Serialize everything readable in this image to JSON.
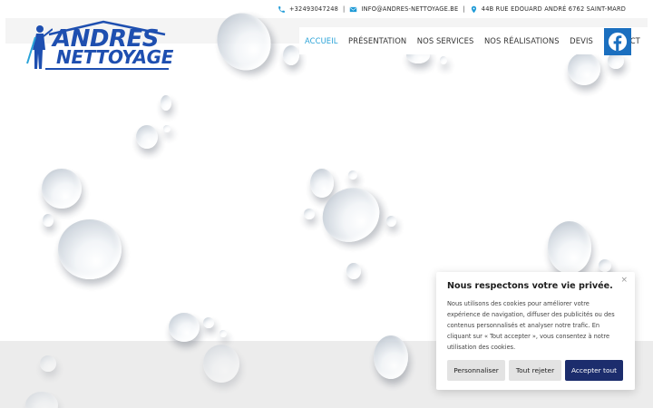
{
  "topbar": {
    "phone": "+32493047248",
    "email": "INFO@ANDRES-NETTOYAGE.BE",
    "address": "44B RUE EDOUARD ANDRÉ 6762 SAINT-MARD",
    "separator": "|"
  },
  "logo": {
    "line1": "ANDRES",
    "line2": "NETTOYAGE"
  },
  "nav": {
    "items": [
      {
        "label": "ACCUEIL",
        "active": true
      },
      {
        "label": "PRÉSENTATION"
      },
      {
        "label": "NOS SERVICES"
      },
      {
        "label": "NOS RÉALISATIONS"
      },
      {
        "label": "DEVIS"
      },
      {
        "label": "CONTACT"
      }
    ]
  },
  "social": {
    "icon": "facebook-icon"
  },
  "cookie": {
    "title": "Nous respectons votre vie privée.",
    "text": "Nous utilisons des cookies pour améliorer votre expérience de navigation, diffuser des publicités ou des contenus personnalisés et analyser notre trafic. En cliquant sur « Tout accepter », vous consentez à notre utilisation des cookies.",
    "close": "×",
    "btn_customize": "Personnaliser",
    "btn_reject": "Tout rejeter",
    "btn_accept": "Accepter tout"
  },
  "colors": {
    "accent": "#2aa3d8",
    "brand": "#1e4fb0",
    "facebook": "#1b6fbf",
    "accept_button": "#1c2d6d"
  }
}
